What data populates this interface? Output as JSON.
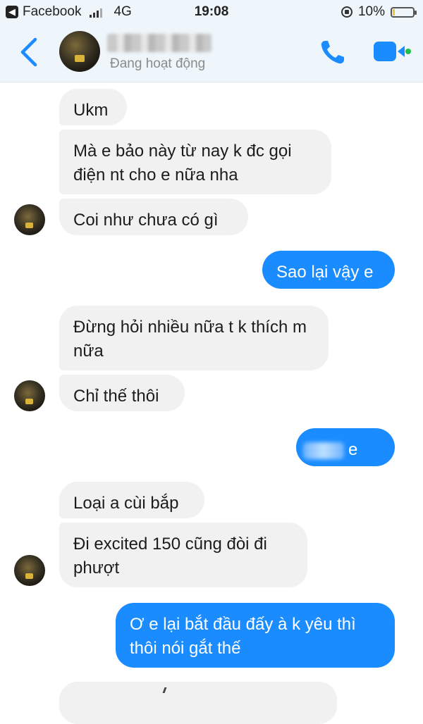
{
  "status_bar": {
    "carrier": "Facebook",
    "network": "4G",
    "time": "19:08",
    "battery": "10%",
    "battery_level": 0.1
  },
  "header": {
    "status": "Đang hoạt động",
    "icons": [
      "back-icon",
      "phone-icon",
      "video-camera-icon"
    ],
    "accent_color": "#1a8cff"
  },
  "messages": [
    {
      "side": "in",
      "text": "Ukm"
    },
    {
      "side": "in",
      "text": "Mà e bảo này từ nay k đc gọi điện nt cho e nữa nha"
    },
    {
      "side": "in",
      "text": "Coi như chưa có gì"
    },
    {
      "side": "out",
      "text": "Sao lại vậy e"
    },
    {
      "side": "in",
      "text": "Đừng hỏi nhiều nữa t k thích m nữa"
    },
    {
      "side": "in",
      "text": "Chỉ thế thôi"
    },
    {
      "side": "out",
      "text": "e lun"
    },
    {
      "side": "in",
      "text": "Loại a cùi bắp"
    },
    {
      "side": "in",
      "text": "Đi excited 150 cũng đòi đi phượt"
    },
    {
      "side": "out",
      "text": "Ơ e lại bắt đầu đấy à k yêu thì thôi nói gắt thế"
    }
  ]
}
